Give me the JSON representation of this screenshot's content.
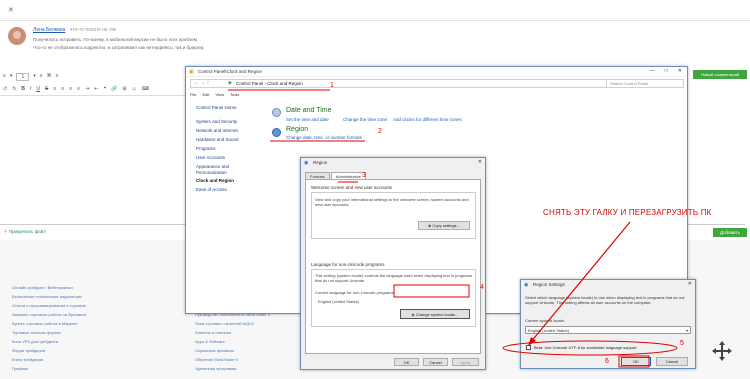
{
  "forum": {
    "close_label": "✕",
    "author": "Лена Белкина",
    "post_meta": "что-то пошло не так",
    "post_lines": [
      "Получилось исправить. По-моему, в мобильной версии не было этих проблем.",
      "Что-то не отобразилось корректно, и затрагивают как интерфейсы, так и браузер."
    ],
    "new_comment_button": "Новый комментарий",
    "attach_files": "Прикрепить файл",
    "add_button": "Добавить",
    "editor_toolbar_row1": [
      "≡",
      "▾",
      "1",
      "▾",
      "≡",
      "⌘",
      "≡"
    ],
    "editor_toolbar_row2": [
      "↺",
      "↻",
      "B",
      "I",
      "U",
      "S",
      "≡",
      "≡",
      "≡",
      "≡",
      "⇥",
      "⇤",
      "❝",
      "🔗",
      "⊞",
      "☺",
      "⌨"
    ]
  },
  "footer": {
    "col1": [
      "Онлайн-трейдинг / Вебтерминал",
      "Бесплатные технические индикаторы",
      "Статьи о программировании и торговле",
      "Заказать торгового робота на Фрилансе",
      "Купить торгового робота в Маркете",
      "Торговые сигналы форекс",
      "Копи VPS для трейдинга",
      "Форум трейдеров",
      "Книги трейдеров",
      "Графики"
    ],
    "col2": [
      "Руководство пользователя MetaTrader 5",
      "Язык торговых стратегий MQL5",
      "Клиенты и платежи",
      "Apps & Software",
      "Сервисные финансы",
      "Обучение MetaTrader 5",
      "Удаленная программа"
    ]
  },
  "control_panel": {
    "title": "Control Panel\\Clock and Region",
    "window_buttons": [
      "—",
      "□",
      "✕"
    ],
    "address": "Control Panel  ›  Clock and Region",
    "search_placeholder": "Search Control Panel",
    "menu": [
      "File",
      "Edit",
      "View",
      "Tools"
    ],
    "sidebar": [
      "Control Panel Home",
      "System and Security",
      "Network and Internet",
      "Hardware and Sound",
      "Programs",
      "User Accounts",
      "Appearance and",
      "Personalization",
      "Clock and Region",
      "Ease of Access"
    ],
    "sections": [
      {
        "title": "Date and Time",
        "links": [
          "Set the time and date",
          "Change the time zone",
          "Add clocks for different time zones"
        ]
      },
      {
        "title": "Region",
        "links": [
          "Change date, time, or number formats"
        ]
      }
    ]
  },
  "region_dialog": {
    "title": "Region",
    "close": "✕",
    "tabs": [
      "Formats",
      "Administrative"
    ],
    "welcome_group": "Welcome screen and new user accounts",
    "welcome_text": "View and copy your international settings to the welcome screen, system accounts and new user accounts.",
    "copy_button": "Copy settings...",
    "nonunicode_group": "Language for non-Unicode programs",
    "nonunicode_text": "This setting (system locale) controls the language used when displaying text in programs that do not support Unicode.",
    "current_language_label": "Current language for non-Unicode programs:",
    "current_language": "English (United States)",
    "change_locale_button": "Change system locale...",
    "ok": "OK",
    "cancel": "Cancel",
    "apply": "Apply"
  },
  "region_settings": {
    "title": "Region Settings",
    "description": "Select which language (system locale) to use when displaying text in programs that do not support Unicode. This setting affects all user accounts on the computer.",
    "current_locale_label": "Current system locale:",
    "current_locale": "English (United States)",
    "beta_checkbox": "Beta: Use Unicode UTF-8 for worldwide language support",
    "ok": "OK",
    "cancel": "Cancel"
  },
  "annotations": {
    "instruction": "СНЯТЬ ЭТУ ГАЛКУ И ПЕРЕЗАГРУЗИТЬ ПК",
    "steps": [
      "1",
      "2",
      "3",
      "4",
      "5",
      "6"
    ]
  },
  "colors": {
    "accent_green": "#3fa63f",
    "annotation_red": "#e00000",
    "link_blue": "#1a5fb4"
  }
}
